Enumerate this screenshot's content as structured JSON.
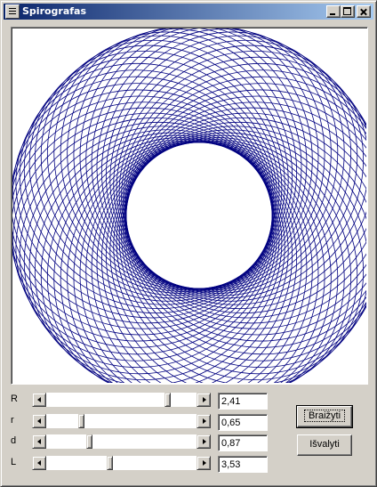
{
  "window": {
    "title": "Spirografas",
    "controls": [
      "minimize",
      "maximize",
      "close"
    ]
  },
  "canvas": {
    "line_color": "#000080",
    "background": "#ffffff"
  },
  "params": [
    {
      "label": "R",
      "value": "2,41",
      "slider_fraction": 0.82
    },
    {
      "label": "r",
      "value": "0,65",
      "slider_fraction": 0.22
    },
    {
      "label": "d",
      "value": "0,87",
      "slider_fraction": 0.28
    },
    {
      "label": "L",
      "value": "3,53",
      "slider_fraction": 0.42
    }
  ],
  "buttons": {
    "draw": "Braižyti",
    "clear": "Išvalyti"
  }
}
